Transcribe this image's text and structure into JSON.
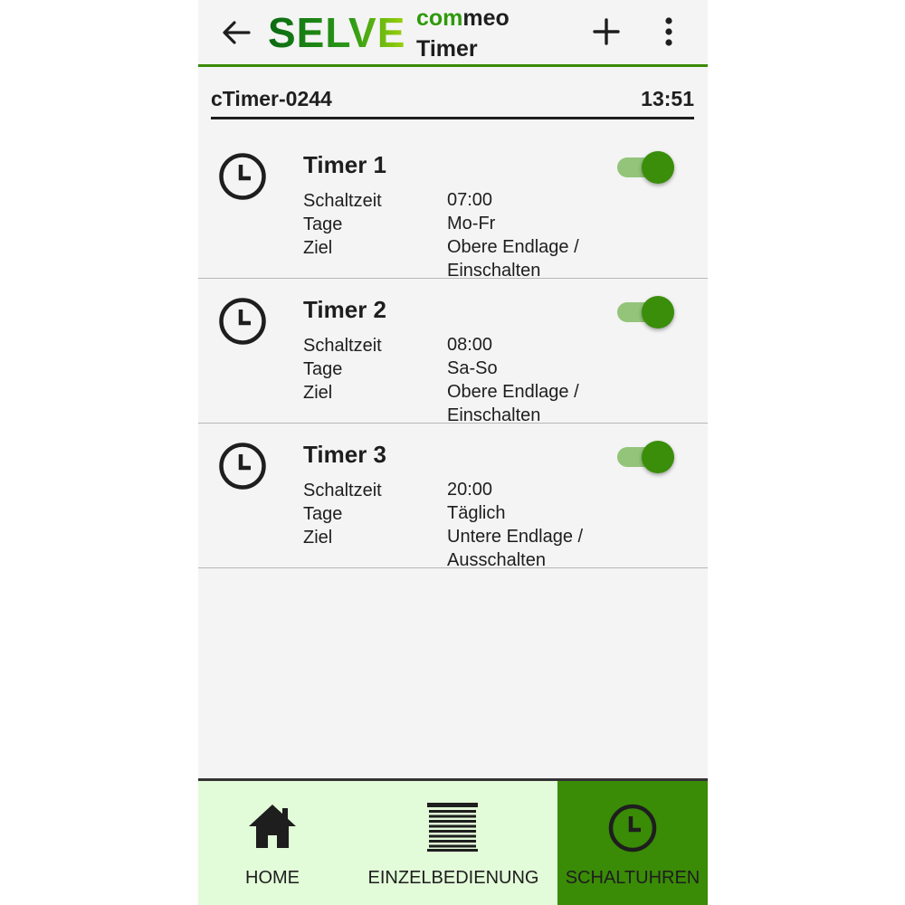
{
  "header": {
    "logo": "SELVE",
    "brand_com": "com",
    "brand_meo": "meo",
    "screen_title": "Timer",
    "back_icon": "arrow-left-icon",
    "add_icon": "plus-icon",
    "more_icon": "more-vertical-icon"
  },
  "device": {
    "name": "cTimer-0244",
    "time": "13:51"
  },
  "timers": [
    {
      "title": "Timer 1",
      "enabled": true,
      "labels": {
        "time": "Schaltzeit",
        "days": "Tage",
        "target": "Ziel"
      },
      "time": "07:00",
      "days": "Mo-Fr",
      "target_line1": "Obere Endlage /",
      "target_line2": "Einschalten"
    },
    {
      "title": "Timer 2",
      "enabled": true,
      "labels": {
        "time": "Schaltzeit",
        "days": "Tage",
        "target": "Ziel"
      },
      "time": "08:00",
      "days": "Sa-So",
      "target_line1": "Obere Endlage /",
      "target_line2": "Einschalten"
    },
    {
      "title": "Timer 3",
      "enabled": true,
      "labels": {
        "time": "Schaltzeit",
        "days": "Tage",
        "target": "Ziel"
      },
      "time": "20:00",
      "days": "Täglich",
      "target_line1": "Untere Endlage /",
      "target_line2": "Ausschalten"
    }
  ],
  "nav": {
    "home": "HOME",
    "single": "EINZELBEDIENUNG",
    "timers": "SCHALTUHREN",
    "active": "timers"
  },
  "colors": {
    "accent": "#3a8b06",
    "nav_bg": "#e2fbd8",
    "toggle_track": "#93c47a"
  }
}
